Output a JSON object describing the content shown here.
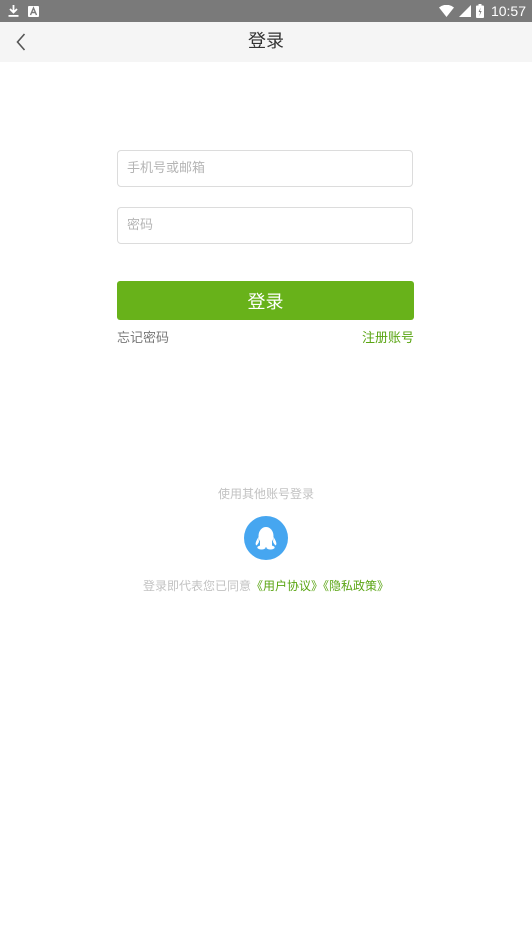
{
  "status_bar": {
    "time": "10:57",
    "icons": [
      "download-icon",
      "app-notification-icon",
      "wifi-icon",
      "signal-icon",
      "battery-icon"
    ]
  },
  "header": {
    "title": "登录",
    "back_icon": "chevron-left-icon"
  },
  "form": {
    "phone_placeholder": "手机号或邮箱",
    "phone_value": "",
    "password_placeholder": "密码",
    "password_value": "",
    "login_label": "登录",
    "forgot_label": "忘记密码",
    "register_label": "注册账号"
  },
  "social": {
    "label": "使用其他账号登录",
    "qq_icon": "qq-penguin-icon"
  },
  "agreement": {
    "prefix": "登录即代表您已同意",
    "user_agreement": "《用户协议》",
    "privacy_policy": "《隐私政策》"
  },
  "colors": {
    "accent": "#68b21a",
    "link_green": "#5aa513",
    "qq_blue": "#46a6f0",
    "status_bar": "#7a7a7a",
    "header_bg": "#f5f5f5"
  }
}
